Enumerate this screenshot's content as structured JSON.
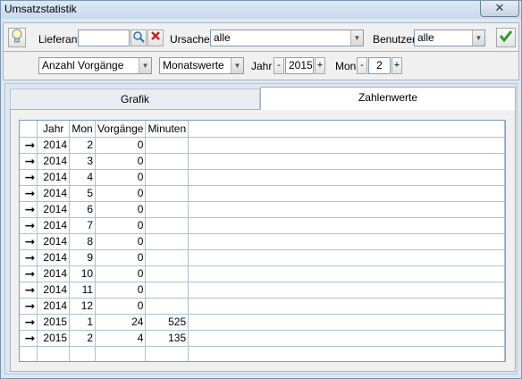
{
  "window": {
    "title": "Umsatzstatistik",
    "close_symbol": "✕"
  },
  "filters": {
    "lieferant_label": "Lieferant",
    "lieferant_value": "",
    "ursache_label": "Ursache",
    "ursache_value": "alle",
    "benutzer_label": "Benutzer",
    "benutzer_value": "alle"
  },
  "options": {
    "measure_value": "Anzahl Vorgänge",
    "period_value": "Monatswerte",
    "jahr_label": "Jahr",
    "jahr_value": "2015",
    "mon_label": "Mon",
    "mon_value": "2",
    "minus": "-",
    "plus": "+"
  },
  "tabs": [
    {
      "label": "Grafik",
      "active": false
    },
    {
      "label": "Zahlenwerte",
      "active": true
    }
  ],
  "table": {
    "columns": [
      "",
      "Jahr",
      "Mon",
      "Vorgänge",
      "Minuten"
    ],
    "row_marker": "➞",
    "rows": [
      [
        "2014",
        "2",
        "0",
        ""
      ],
      [
        "2014",
        "3",
        "0",
        ""
      ],
      [
        "2014",
        "4",
        "0",
        ""
      ],
      [
        "2014",
        "5",
        "0",
        ""
      ],
      [
        "2014",
        "6",
        "0",
        ""
      ],
      [
        "2014",
        "7",
        "0",
        ""
      ],
      [
        "2014",
        "8",
        "0",
        ""
      ],
      [
        "2014",
        "9",
        "0",
        ""
      ],
      [
        "2014",
        "10",
        "0",
        ""
      ],
      [
        "2014",
        "11",
        "0",
        ""
      ],
      [
        "2014",
        "12",
        "0",
        ""
      ],
      [
        "2015",
        "1",
        "24",
        "525"
      ],
      [
        "2015",
        "2",
        "4",
        "135"
      ]
    ]
  },
  "icons": {
    "hint": "lightbulb-icon",
    "search": "magnifier-icon",
    "clear": "red-x-icon",
    "confirm": "green-check-icon"
  }
}
